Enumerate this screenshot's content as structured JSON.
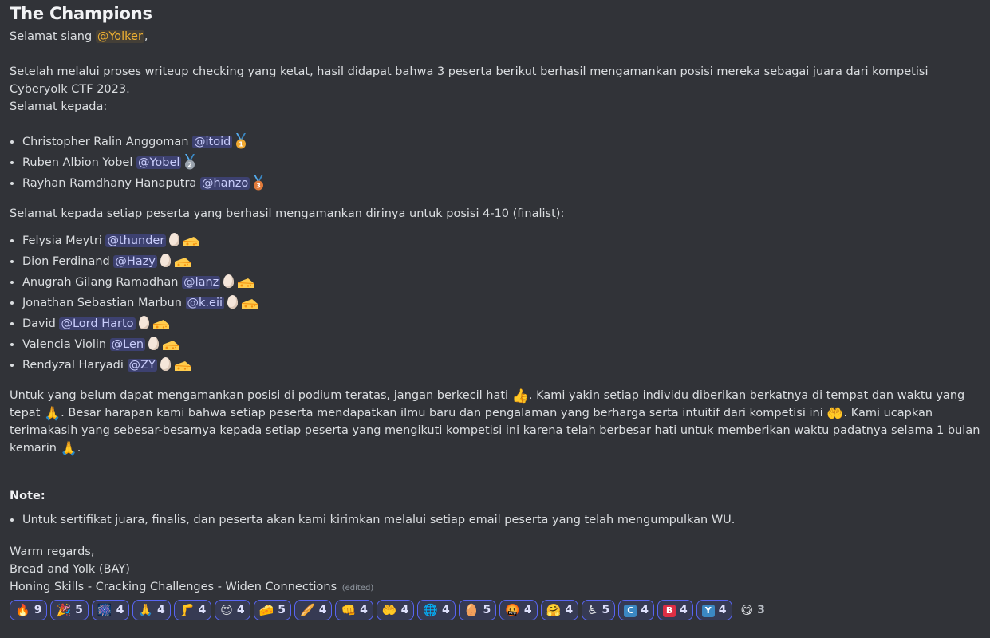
{
  "title": "The Champions",
  "greeting": {
    "prefix": "Selamat siang ",
    "mention": "@Yolker",
    "suffix": ","
  },
  "intro_line1": "Setelah melalui proses writeup checking yang ketat, hasil didapat bahwa 3 peserta berikut berhasil mengamankan posisi mereka sebagai juara dari kompetisi Cyberyolk CTF 2023.",
  "intro_line2": "Selamat kepada:",
  "winners": [
    {
      "name": "Christopher Ralin Anggoman ",
      "mention": "@itoid",
      "medal": "1",
      "medal_color": "#f0a830"
    },
    {
      "name": "Ruben Albion Yobel ",
      "mention": "@Yobel",
      "medal": "2",
      "medal_color": "#9aa3ad"
    },
    {
      "name": "Rayhan Ramdhany Hanaputra ",
      "mention": "@hanzo",
      "medal": "3",
      "medal_color": "#e07a3a"
    }
  ],
  "finalist_intro": "Selamat kepada setiap peserta yang berhasil mengamankan dirinya untuk posisi 4-10 (finalist):",
  "finalists": [
    {
      "name": "Felysia Meytri ",
      "mention": "@thunder"
    },
    {
      "name": "Dion Ferdinand ",
      "mention": "@Hazy"
    },
    {
      "name": "Anugrah Gilang Ramadhan ",
      "mention": "@lanz"
    },
    {
      "name": "Jonathan Sebastian Marbun ",
      "mention": "@k.eii"
    },
    {
      "name": "David ",
      "mention": "@Lord Harto"
    },
    {
      "name": "Valencia Violin ",
      "mention": "@Len"
    },
    {
      "name": "Rendyzal Haryadi ",
      "mention": "@ZY"
    }
  ],
  "encourage": {
    "p1": "Untuk yang belum dapat mengamankan posisi di podium teratas, jangan berkecil hati ",
    "e1": "👍",
    "p2": ". Kami yakin setiap individu diberikan berkatnya di tempat dan waktu yang tepat ",
    "e2": "🙏",
    "p3": ". Besar harapan kami bahwa setiap peserta mendapatkan ilmu baru dan pengalaman yang berharga serta intuitif dari kompetisi ini ",
    "e3": "🤲",
    "p4": ". Kami ucapkan terimakasih yang sebesar-besarnya kepada setiap peserta yang mengikuti kompetisi ini karena telah berbesar hati untuk memberikan waktu padatnya selama 1 bulan kemarin ",
    "e4": "🙏",
    "p5": "."
  },
  "note_label": "Note:",
  "note_item": "Untuk sertifikat juara, finalis, dan peserta akan kami kirimkan melalui setiap email peserta yang telah mengumpulkan WU.",
  "signoff": [
    "Warm regards,",
    "Bread and Yolk (BAY)",
    "Honing Skills - Cracking Challenges - Widen Connections"
  ],
  "edited_label": "(edited)",
  "reactions": [
    {
      "emoji": "🔥",
      "count": "9"
    },
    {
      "emoji": "🎉",
      "count": "5"
    },
    {
      "emoji": "🎆",
      "count": "4"
    },
    {
      "emoji": "🙏",
      "count": "4"
    },
    {
      "emoji": "🦵",
      "count": "4"
    },
    {
      "emoji": "😍",
      "count": "4"
    },
    {
      "emoji": "🧀",
      "count": "5"
    },
    {
      "emoji": "🥖",
      "count": "4"
    },
    {
      "emoji": "👊",
      "count": "4"
    },
    {
      "emoji": "🤲",
      "count": "4"
    },
    {
      "emoji": "🌐",
      "count": "4"
    },
    {
      "emoji": "🥚",
      "count": "5"
    },
    {
      "emoji": "🤬",
      "count": "4"
    },
    {
      "emoji": "🤗",
      "count": "4"
    },
    {
      "emoji": "♿",
      "count": "5"
    },
    {
      "emoji": "C",
      "count": "4",
      "color": "#3b88c3"
    },
    {
      "emoji": "B",
      "count": "4",
      "color": "#dd2e44"
    },
    {
      "emoji": "Y",
      "count": "4",
      "color": "#3b88c3"
    },
    {
      "emoji": "😋",
      "count": "3",
      "plain": true
    }
  ]
}
